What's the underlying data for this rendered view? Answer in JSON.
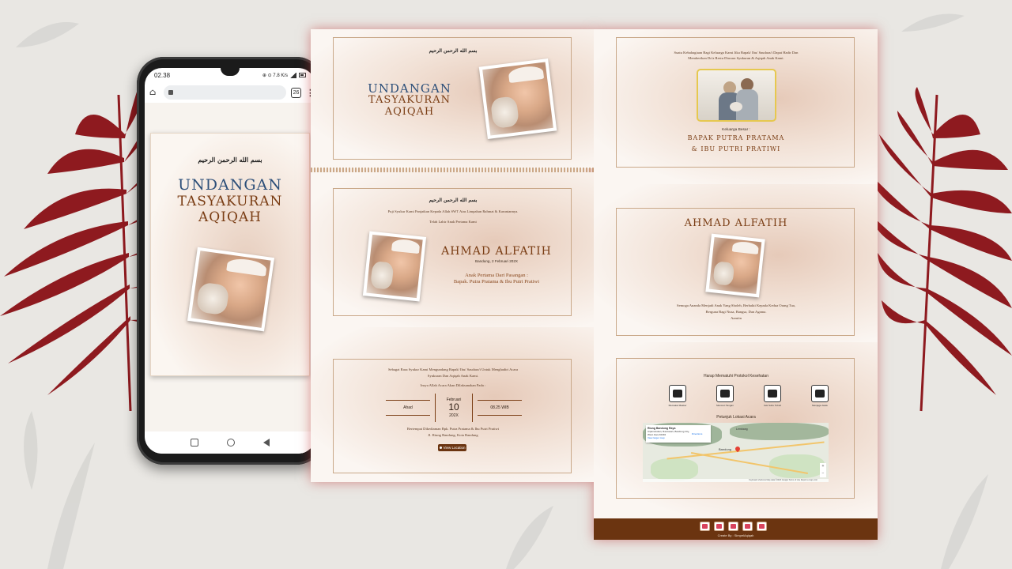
{
  "phone": {
    "time": "02.38",
    "status_icons": "⊕ ⊙ 7.8 K/s",
    "url_value": "",
    "tab_count": "26",
    "menu": "⋮",
    "card": {
      "bismillah": "بسم الله الرحمن الرحيم",
      "title_line1": "UNDANGAN",
      "title_line2": "TASYAKURAN",
      "title_line3": "AQIQAH"
    }
  },
  "cover": {
    "bismillah": "بسم الله الرحمن الرحيم",
    "title_line1": "UNDANGAN",
    "title_line2": "TASYAKURAN",
    "title_line3": "AQIQAH"
  },
  "announce": {
    "bismillah": "بسم الله الرحمن الرحيم",
    "intro": "Puji Syukur Kami Panjatkan Kepada Allah SWT Atas Limpahan Rahmat & Karuniannya.",
    "intro2": "Telah Lahir Anak Pertama Kami",
    "name": "AHMAD ALFATIH",
    "birth": "Bandung, 2 Februari 202X",
    "parents_label": "Anak Pertama Dari Pasangan :",
    "parents": "Bapak. Putra Pratama & Ibu Putri Pratiwi"
  },
  "event": {
    "text1": "Sebagai Rasa Syukur Kami Mengundang Bapak/ Ibu/ Saudara/i Untuk Menghadiri Acara",
    "text2": "Syukuran Dan Aqiqah Anak Kami.",
    "text3": "Insya Allah Acara Akan Dilaksanakan Pada :",
    "day": "Ahad",
    "month": "Februari",
    "date": "10",
    "year": "202X",
    "time": "08.25 WIB",
    "place1": "Bertempat Dikediaman Bpk. Putra Pratama & Ibu Putri Pratiwi",
    "place2": "Jl. Riung Bandung, Kota Bandung",
    "location_button": "View Location"
  },
  "family": {
    "text1": "Suatu Kebahagiaan Bagi Keluarga Kami Jika Bapak/ Ibu/ Saudara/i Dapat Hadir Dan",
    "text2": "Memberikan Do'a Restu Diacara Syukuran & Aqiqah Anak Kami.",
    "label": "Keluarga Besar :",
    "line1": "BAPAK PUTRA PRATAMA",
    "line2": "& IBU PUTRI PRATIWI"
  },
  "prayer": {
    "name": "AHMAD ALFATIH",
    "text1": "Semoga Ananda Menjadi Anak Yang Sholeh, Berbakti Kepada Kedua Orang Tua,",
    "text2": "Berguna Bagi Nusa, Bangsa, Dan Agama.",
    "text3": "Aamiin"
  },
  "protocol": {
    "title": "Harap Mematuhi Protokol Kesehatan",
    "items": [
      "Memakai Masker",
      "Mencuci Tangan",
      "Cek Suhu Tubuh",
      "Menjaga Jarak"
    ],
    "map_title": "Petunjuk Lokasi Acara",
    "map_place": "Riung Bandung Raya",
    "map_address": "Cipamokolan, Rancasari, Bandung City, West Java 40292",
    "map_directions": "Directions",
    "map_larger": "View larger map",
    "map_city": "Bandung",
    "map_city2": "Lembang",
    "map_footer": "Keyboard shortcuts  Map data ©2023 Google  Terms of Use  Report a map error"
  },
  "footer": {
    "credit": "Create By : SimpelAqiqah"
  },
  "colors": {
    "accent_brown": "#7a3d14",
    "accent_blue": "#2d4f79",
    "footer_bg": "#6b3410",
    "leaf_red": "#8e1a1f"
  }
}
